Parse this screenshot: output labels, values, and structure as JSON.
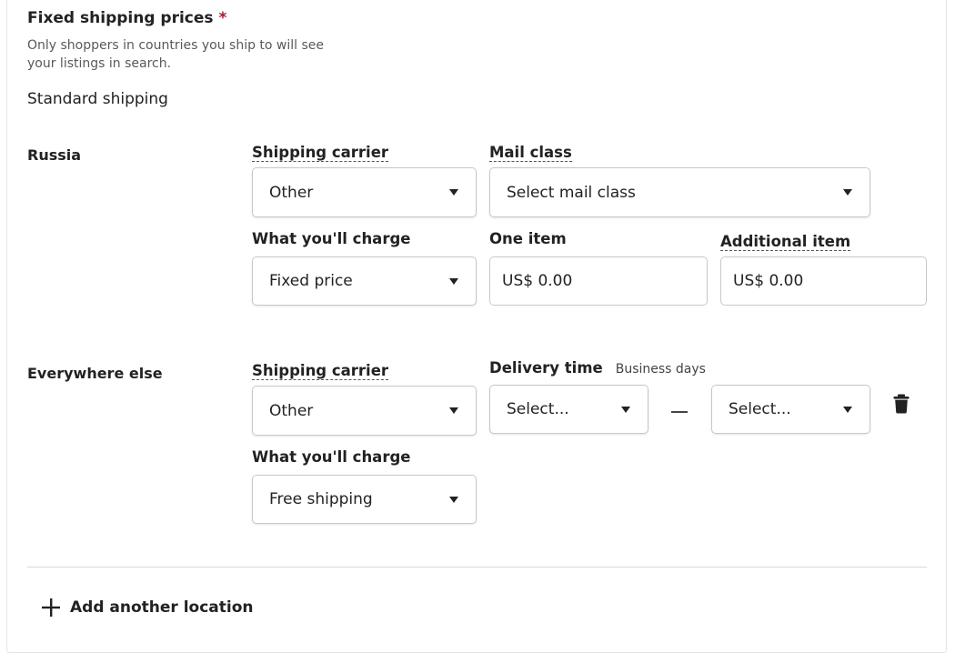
{
  "section": {
    "title": "Fixed shipping prices",
    "required_mark": "*",
    "description": "Only shoppers in countries you ship to will see your listings in search.",
    "subtitle": "Standard shipping"
  },
  "russia": {
    "location": "Russia",
    "shipping_carrier_label": "Shipping carrier",
    "shipping_carrier_value": "Other",
    "mail_class_label": "Mail class",
    "mail_class_value": "Select mail class",
    "charge_label": "What you'll charge",
    "charge_value": "Fixed price",
    "one_item_label": "One item",
    "one_item_value": "US$ 0.00",
    "additional_item_label": "Additional item",
    "additional_item_value": "US$ 0.00"
  },
  "everywhere": {
    "location": "Everywhere else",
    "shipping_carrier_label": "Shipping carrier",
    "shipping_carrier_value": "Other",
    "delivery_time_label": "Delivery time",
    "delivery_time_hint": "Business days",
    "delivery_min_value": "Select...",
    "delivery_max_value": "Select...",
    "delete_icon": "trash-icon",
    "charge_label": "What you'll charge",
    "charge_value": "Free shipping"
  },
  "add_location": {
    "label": "Add another location",
    "icon": "plus-icon"
  }
}
